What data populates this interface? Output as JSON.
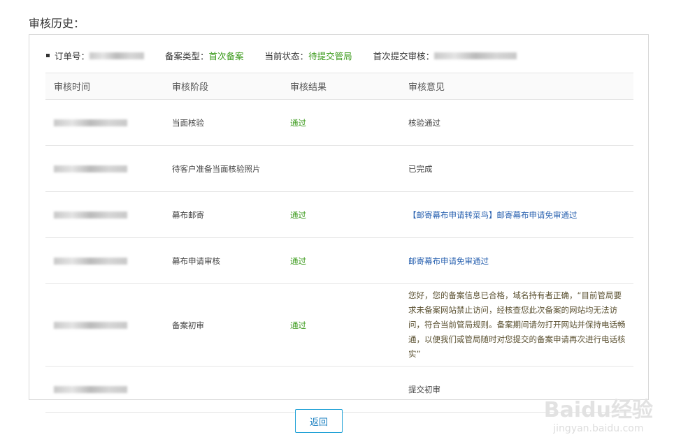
{
  "title": "审核历史：",
  "info": {
    "order_label": "订单号：",
    "type_label": "备案类型：",
    "type_value": "首次备案",
    "status_label": "当前状态：",
    "status_value": "待提交管局",
    "first_label": "首次提交审核："
  },
  "table": {
    "headers": [
      "审核时间",
      "审核阶段",
      "审核结果",
      "审核意见"
    ],
    "rows": [
      {
        "stage": "当面核验",
        "result": "通过",
        "comment": "核验通过"
      },
      {
        "stage": "待客户准备当面核验照片",
        "result": "",
        "comment": "已完成"
      },
      {
        "stage": "幕布邮寄",
        "result": "通过",
        "comment": "【邮寄幕布申请转菜鸟】邮寄幕布申请免审通过"
      },
      {
        "stage": "幕布申请审核",
        "result": "通过",
        "comment": "邮寄幕布申请免审通过"
      },
      {
        "stage": "备案初审",
        "result": "通过",
        "comment": "您好，您的备案信息已合格，域名持有者正确，“目前管局要求未备案网站禁止访问，经核查您此次备案的网站均无法访问，符合当前管局规则。备案期间请勿打开网站并保持电话畅通，以便我们或管局随时对您提交的备案申请再次进行电话核实”"
      },
      {
        "stage": "",
        "result": "",
        "comment": "提交初审"
      }
    ]
  },
  "back_label": "返回",
  "watermark": {
    "logo": "Baidu经验",
    "url": "jingyan.baidu.com"
  }
}
